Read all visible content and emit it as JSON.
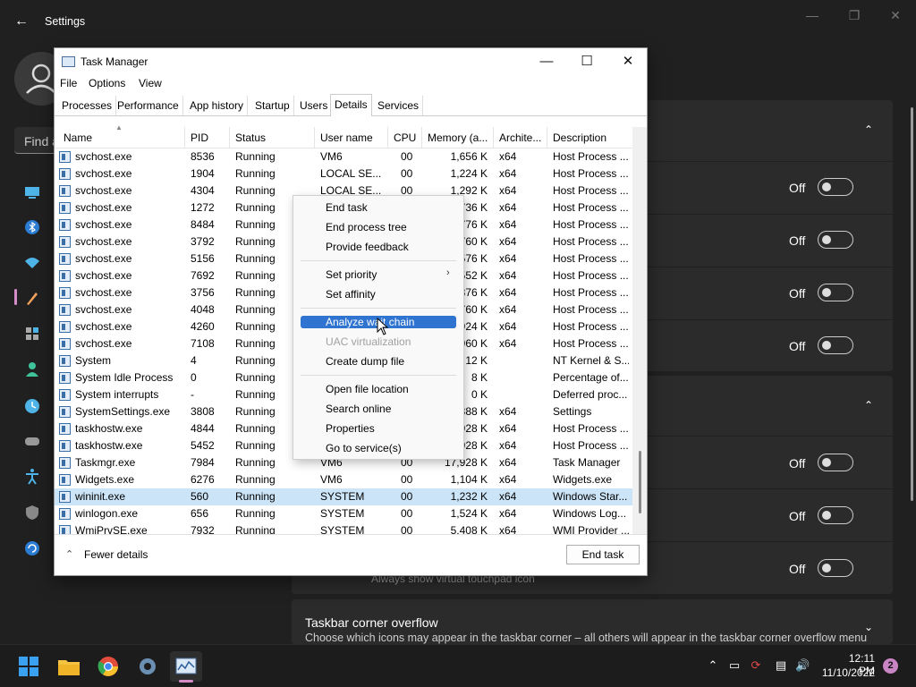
{
  "settings": {
    "title": "Settings",
    "find_placeholder": "Find a",
    "toggle_rows": [
      {
        "state": "Off"
      },
      {
        "state": "Off"
      },
      {
        "state": "Off"
      },
      {
        "state": "Off"
      },
      {
        "state": "Off"
      },
      {
        "state": "Off"
      },
      {
        "state": "Off"
      }
    ],
    "touchpad_sub": "Always show virtual touchpad icon",
    "overflow_title": "Taskbar corner overflow",
    "overflow_sub": "Choose which icons may appear in the taskbar corner – all others will appear in the taskbar corner overflow menu"
  },
  "taskmanager": {
    "title": "Task Manager",
    "menu": [
      "File",
      "Options",
      "View"
    ],
    "tabs": [
      "Processes",
      "Performance",
      "App history",
      "Startup",
      "Users",
      "Details",
      "Services"
    ],
    "selected_tab": "Details",
    "columns": [
      "Name",
      "PID",
      "Status",
      "User name",
      "CPU",
      "Memory (a...",
      "Archite...",
      "Description"
    ],
    "rows": [
      {
        "name": "svchost.exe",
        "pid": "8536",
        "status": "Running",
        "user": "VM6",
        "cpu": "00",
        "mem": "1,656 K",
        "arch": "x64",
        "desc": "Host Process ..."
      },
      {
        "name": "svchost.exe",
        "pid": "1904",
        "status": "Running",
        "user": "LOCAL SE...",
        "cpu": "00",
        "mem": "1,224 K",
        "arch": "x64",
        "desc": "Host Process ..."
      },
      {
        "name": "svchost.exe",
        "pid": "4304",
        "status": "Running",
        "user": "LOCAL SE...",
        "cpu": "00",
        "mem": "1,292 K",
        "arch": "x64",
        "desc": "Host Process ..."
      },
      {
        "name": "svchost.exe",
        "pid": "1272",
        "status": "Running",
        "user": "",
        "cpu": "",
        "mem": "736 K",
        "arch": "x64",
        "desc": "Host Process ..."
      },
      {
        "name": "svchost.exe",
        "pid": "8484",
        "status": "Running",
        "user": "",
        "cpu": "",
        "mem": "776 K",
        "arch": "x64",
        "desc": "Host Process ..."
      },
      {
        "name": "svchost.exe",
        "pid": "3792",
        "status": "Running",
        "user": "",
        "cpu": "",
        "mem": "760 K",
        "arch": "x64",
        "desc": "Host Process ..."
      },
      {
        "name": "svchost.exe",
        "pid": "5156",
        "status": "Running",
        "user": "",
        "cpu": "",
        "mem": "576 K",
        "arch": "x64",
        "desc": "Host Process ..."
      },
      {
        "name": "svchost.exe",
        "pid": "7692",
        "status": "Running",
        "user": "",
        "cpu": "",
        "mem": "552 K",
        "arch": "x64",
        "desc": "Host Process ..."
      },
      {
        "name": "svchost.exe",
        "pid": "3756",
        "status": "Running",
        "user": "",
        "cpu": "",
        "mem": "876 K",
        "arch": "x64",
        "desc": "Host Process ..."
      },
      {
        "name": "svchost.exe",
        "pid": "4048",
        "status": "Running",
        "user": "",
        "cpu": "",
        "mem": "760 K",
        "arch": "x64",
        "desc": "Host Process ..."
      },
      {
        "name": "svchost.exe",
        "pid": "4260",
        "status": "Running",
        "user": "",
        "cpu": "",
        "mem": "924 K",
        "arch": "x64",
        "desc": "Host Process ..."
      },
      {
        "name": "svchost.exe",
        "pid": "7108",
        "status": "Running",
        "user": "",
        "cpu": "",
        "mem": "960 K",
        "arch": "x64",
        "desc": "Host Process ..."
      },
      {
        "name": "System",
        "pid": "4",
        "status": "Running",
        "user": "",
        "cpu": "",
        "mem": "12 K",
        "arch": "",
        "desc": "NT Kernel & S..."
      },
      {
        "name": "System Idle Process",
        "pid": "0",
        "status": "Running",
        "user": "",
        "cpu": "",
        "mem": "8 K",
        "arch": "",
        "desc": "Percentage of..."
      },
      {
        "name": "System interrupts",
        "pid": "-",
        "status": "Running",
        "user": "",
        "cpu": "",
        "mem": "0 K",
        "arch": "",
        "desc": "Deferred proc..."
      },
      {
        "name": "SystemSettings.exe",
        "pid": "3808",
        "status": "Running",
        "user": "",
        "cpu": "",
        "mem": "888 K",
        "arch": "x64",
        "desc": "Settings"
      },
      {
        "name": "taskhostw.exe",
        "pid": "4844",
        "status": "Running",
        "user": "",
        "cpu": "",
        "mem": "928 K",
        "arch": "x64",
        "desc": "Host Process ..."
      },
      {
        "name": "taskhostw.exe",
        "pid": "5452",
        "status": "Running",
        "user": "",
        "cpu": "",
        "mem": "928 K",
        "arch": "x64",
        "desc": "Host Process ..."
      },
      {
        "name": "Taskmgr.exe",
        "pid": "7984",
        "status": "Running",
        "user": "VM6",
        "cpu": "00",
        "mem": "17,928 K",
        "arch": "x64",
        "desc": "Task Manager"
      },
      {
        "name": "Widgets.exe",
        "pid": "6276",
        "status": "Running",
        "user": "VM6",
        "cpu": "00",
        "mem": "1,104 K",
        "arch": "x64",
        "desc": "Widgets.exe"
      },
      {
        "name": "wininit.exe",
        "pid": "560",
        "status": "Running",
        "user": "SYSTEM",
        "cpu": "00",
        "mem": "1,232 K",
        "arch": "x64",
        "desc": "Windows Star..."
      },
      {
        "name": "winlogon.exe",
        "pid": "656",
        "status": "Running",
        "user": "SYSTEM",
        "cpu": "00",
        "mem": "1,524 K",
        "arch": "x64",
        "desc": "Windows Log..."
      },
      {
        "name": "WmiPrvSE.exe",
        "pid": "7932",
        "status": "Running",
        "user": "SYSTEM",
        "cpu": "00",
        "mem": "5,408 K",
        "arch": "x64",
        "desc": "WMI Provider ..."
      }
    ],
    "selected_row": "wininit.exe",
    "fewer_details": "Fewer details",
    "end_task": "End task"
  },
  "context_menu": {
    "items": [
      {
        "label": "End task"
      },
      {
        "label": "End process tree"
      },
      {
        "label": "Provide feedback"
      },
      {
        "label": "Set priority",
        "submenu": true
      },
      {
        "label": "Set affinity"
      },
      {
        "label": "Analyze wait chain",
        "highlighted": true
      },
      {
        "label": "UAC virtualization",
        "disabled": true
      },
      {
        "label": "Create dump file"
      },
      {
        "label": "Open file location"
      },
      {
        "label": "Search online"
      },
      {
        "label": "Properties"
      },
      {
        "label": "Go to service(s)"
      }
    ]
  },
  "taskbar": {
    "time": "12:11 PM",
    "date": "11/10/2022",
    "notifications": "2",
    "pinned": [
      "start-icon",
      "file-explorer-icon",
      "chrome-icon",
      "settings-icon",
      "task-manager-icon"
    ]
  },
  "colors": {
    "accent": "#2f74d0",
    "selection": "#cce4f7",
    "nav_highlight": "#d48cc8"
  }
}
